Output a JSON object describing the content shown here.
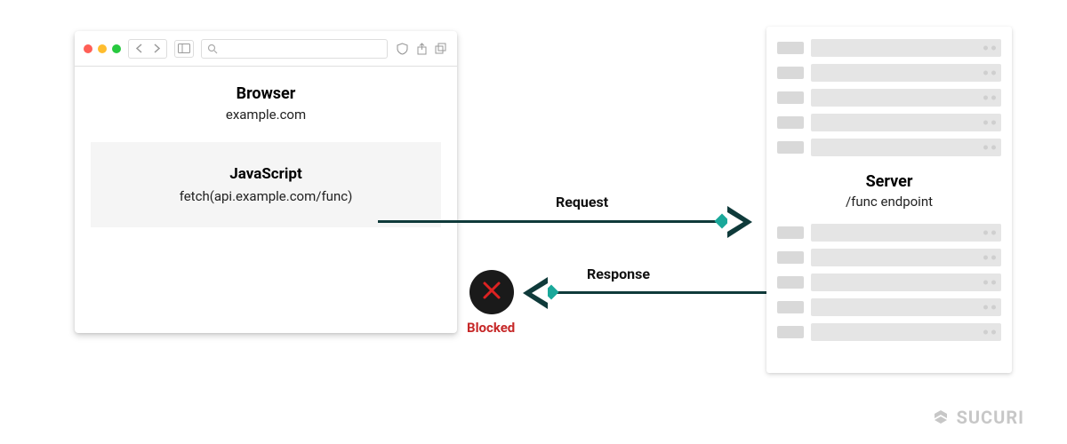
{
  "browser": {
    "title": "Browser",
    "domain": "example.com",
    "js_title": "JavaScript",
    "js_code": "fetch(api.example.com/func)"
  },
  "server": {
    "title": "Server",
    "endpoint": "/func endpoint"
  },
  "labels": {
    "request": "Request",
    "response": "Response",
    "blocked": "Blocked"
  },
  "brand": "SUCURI"
}
